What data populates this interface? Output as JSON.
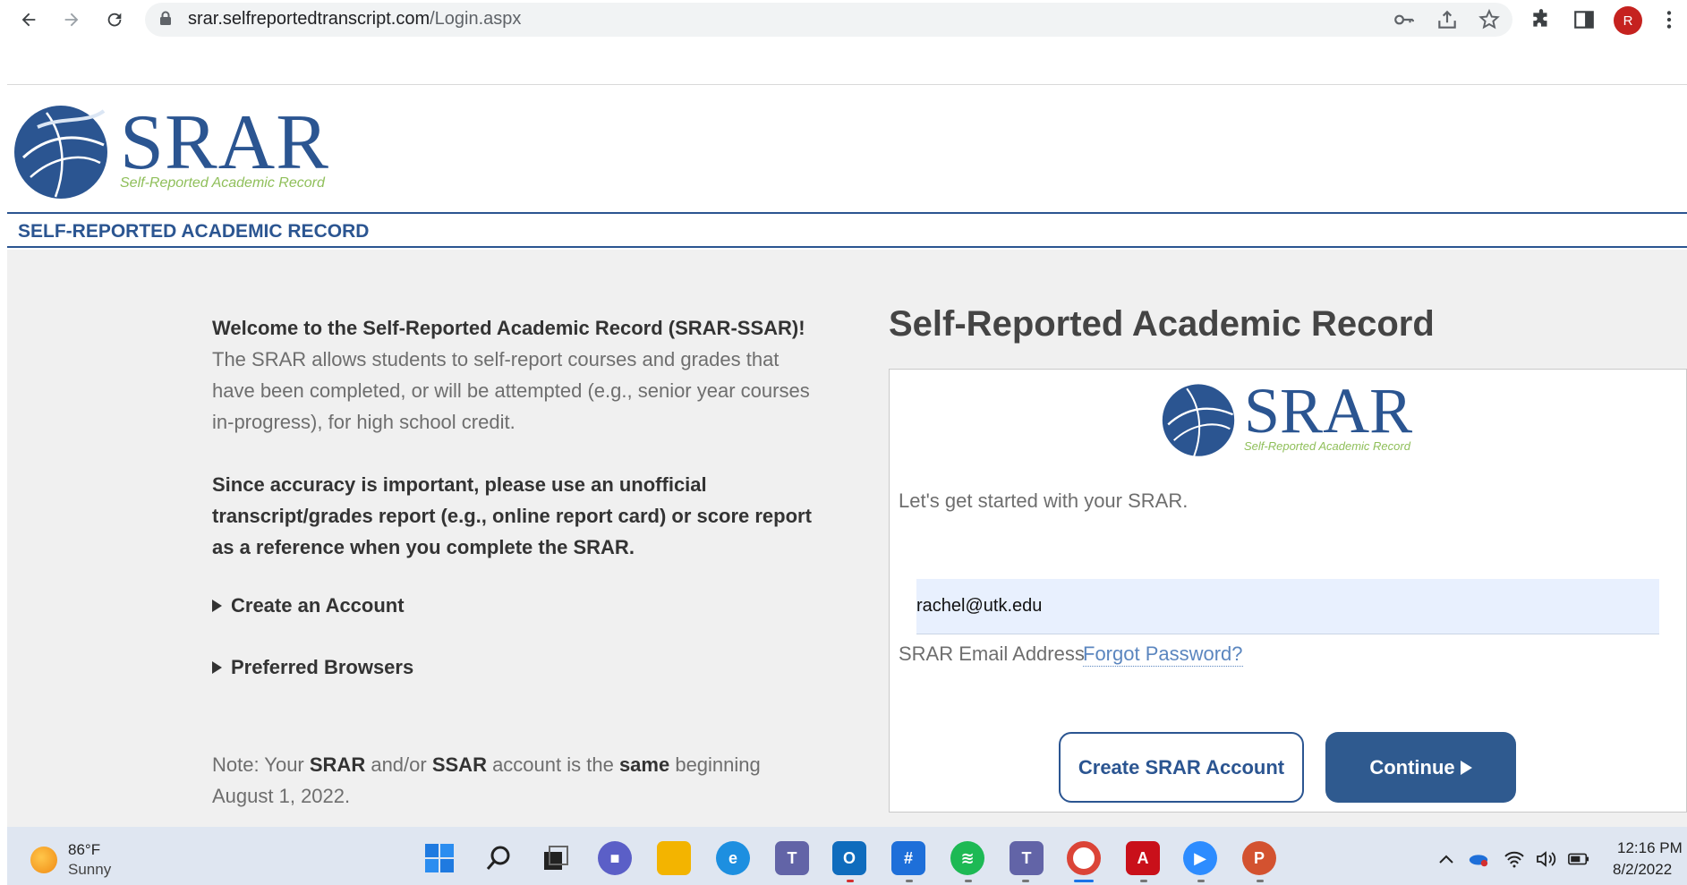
{
  "browser": {
    "url_host": "srar.selfreportedtranscript.com",
    "url_path": "/Login.aspx",
    "avatar_letter": "R"
  },
  "header": {
    "logo_text": "SRAR",
    "logo_tagline": "Self-Reported Academic Record",
    "band_title": "SELF-REPORTED ACADEMIC RECORD"
  },
  "left": {
    "welcome_title": "Welcome to the Self-Reported Academic Record (SRAR-SSAR)!",
    "welcome_body": "The SRAR allows students to self-report courses and grades that have been completed, or will be attempted (e.g., senior year courses in-progress), for high school credit.",
    "accuracy": "Since accuracy is important, please use an unofficial transcript/grades report (e.g., online report card) or score report as a reference when you complete the SRAR.",
    "create_account": "Create an Account",
    "preferred_browsers": "Preferred Browsers",
    "note_prefix": "Note: Your ",
    "note_srar": "SRAR",
    "note_mid1": " and/or ",
    "note_ssar": "SSAR",
    "note_mid2": " account is the ",
    "note_same": "same",
    "note_suffix": " beginning August 1, 2022."
  },
  "login": {
    "title": "Self-Reported Academic Record",
    "logo_text": "SRAR",
    "logo_tagline": "Self-Reported Academic Record",
    "intro": "Let's get started with your SRAR.",
    "email_value": "rachel@utk.edu",
    "email_label": "SRAR Email Address",
    "forgot": "Forgot Password?",
    "create_button": "Create SRAR Account",
    "continue_button": "Continue"
  },
  "taskbar": {
    "temperature": "86°F",
    "condition": "Sunny",
    "time": "12:16 PM",
    "date": "8/2/2022"
  },
  "colors": {
    "brand_blue": "#2b5591",
    "brand_green": "#8fbf5a",
    "button_blue": "#2f5a8f"
  }
}
